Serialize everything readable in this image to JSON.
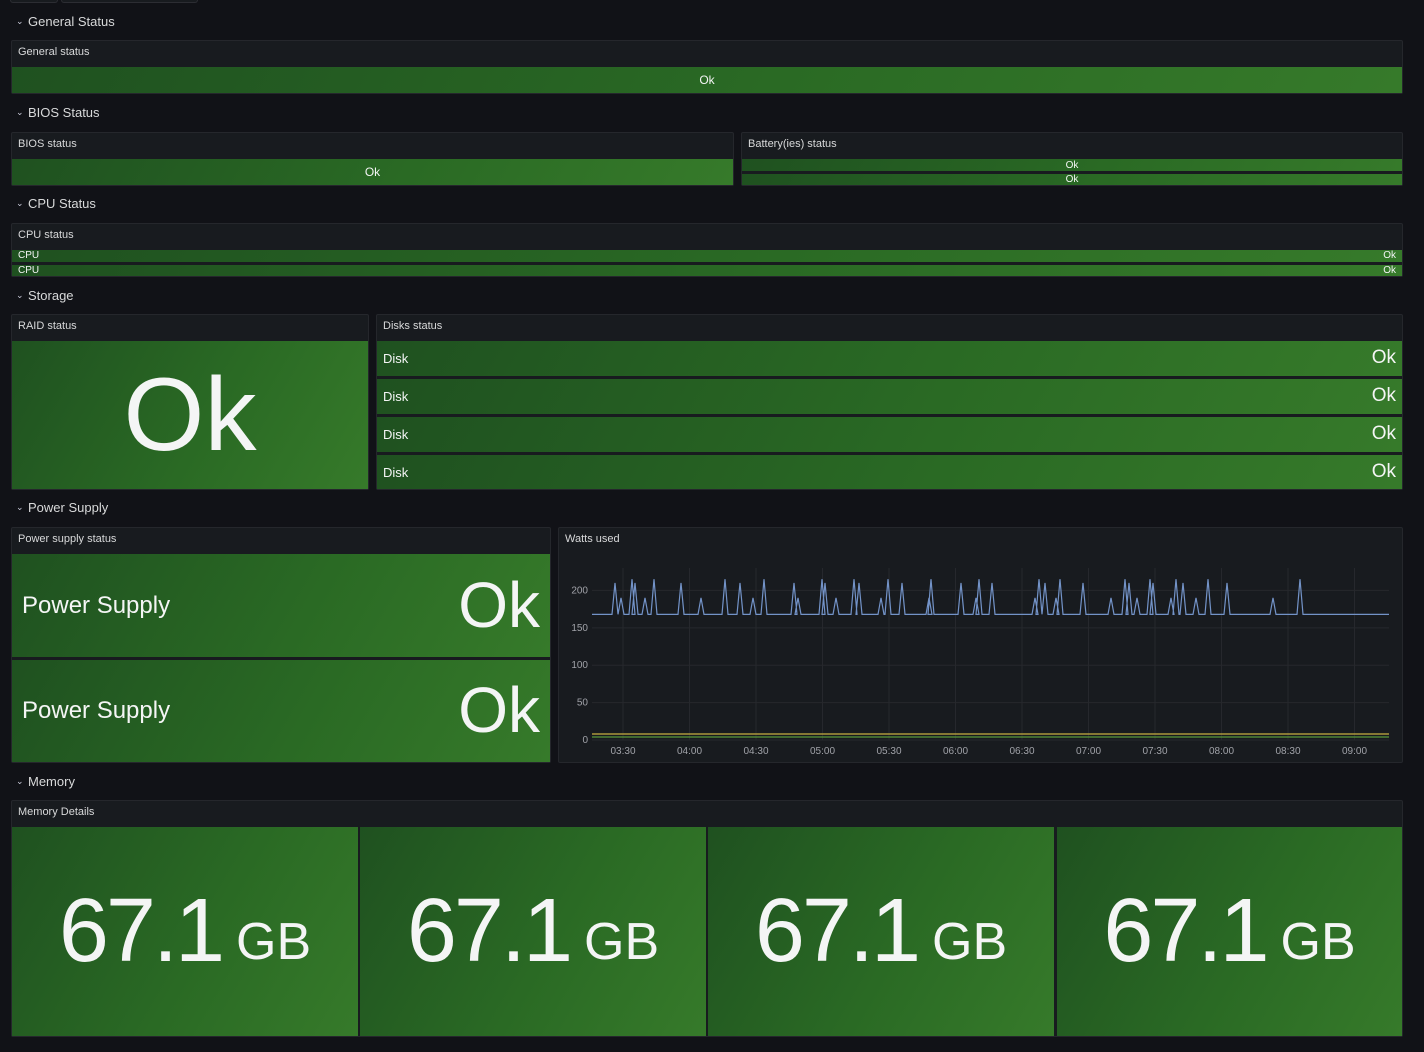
{
  "rows": {
    "general": "General Status",
    "bios": "BIOS Status",
    "cpu": "CPU Status",
    "storage": "Storage",
    "power": "Power Supply",
    "memory": "Memory"
  },
  "panels": {
    "general_status": {
      "title": "General status",
      "value": "Ok"
    },
    "bios_status": {
      "title": "BIOS status",
      "value": "Ok"
    },
    "battery_status": {
      "title": "Battery(ies) status",
      "values": [
        "Ok",
        "Ok"
      ]
    },
    "cpu_status": {
      "title": "CPU status",
      "items": [
        {
          "label": "CPU",
          "value": "Ok"
        },
        {
          "label": "CPU",
          "value": "Ok"
        }
      ]
    },
    "raid_status": {
      "title": "RAID status",
      "value": "Ok"
    },
    "disks_status": {
      "title": "Disks status",
      "items": [
        {
          "label": "Disk",
          "value": "Ok"
        },
        {
          "label": "Disk",
          "value": "Ok"
        },
        {
          "label": "Disk",
          "value": "Ok"
        },
        {
          "label": "Disk",
          "value": "Ok"
        }
      ]
    },
    "power_supply_status": {
      "title": "Power supply status",
      "items": [
        {
          "label": "Power Supply",
          "value": "Ok"
        },
        {
          "label": "Power Supply",
          "value": "Ok"
        }
      ]
    },
    "watts_used": {
      "title": "Watts used"
    },
    "memory_details": {
      "title": "Memory Details",
      "items": [
        {
          "value": "67.1",
          "unit": "GB"
        },
        {
          "value": "67.1",
          "unit": "GB"
        },
        {
          "value": "67.1",
          "unit": "GB"
        },
        {
          "value": "67.1",
          "unit": "GB"
        }
      ]
    }
  },
  "colors": {
    "ok_green": "#2a6a24",
    "series_blue": "#7393c8",
    "series_yellow": "#c8b040",
    "series_green": "#5a9a3a"
  },
  "chart_data": {
    "type": "line",
    "x": [
      "03:30",
      "04:00",
      "04:30",
      "05:00",
      "05:30",
      "06:00",
      "06:30",
      "07:00",
      "07:30",
      "08:00",
      "08:30",
      "09:00"
    ],
    "y_ticks": [
      0,
      50,
      100,
      150,
      200
    ],
    "ylim": [
      0,
      230
    ],
    "series": [
      {
        "color": "#7393c8",
        "baseline": 168,
        "spike_values": [
          210,
          190,
          215
        ],
        "description_note": ""
      },
      {
        "color": "#c8b040",
        "baseline": 8
      },
      {
        "color": "#5a9a3a",
        "baseline": 4
      }
    ]
  }
}
